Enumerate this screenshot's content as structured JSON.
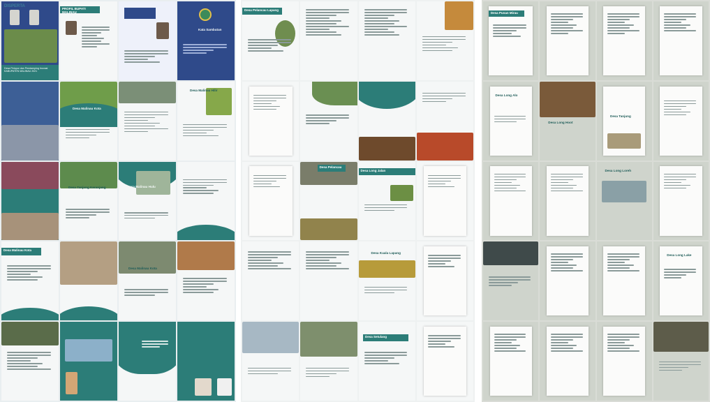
{
  "sheet1": {
    "logo": "DISPERTA",
    "cover_title": "Desa Pelopor dan Pendamping Inovasi KABUPATEN MALINAU 2021",
    "profile_title": "PROFIL BUPATI MALINAU",
    "foreword_title": "Kata Sambutan",
    "village_titles": [
      "Desa Malinau Kota",
      "Desa Malinau Hilir",
      "Desa Tanjung Keranjang",
      "Desa Malinau Hulu",
      "Desa Malinau Kota",
      "Desa Malinau Kota"
    ]
  },
  "sheet2": {
    "village_titles": [
      "Desa Pelancau Lapang",
      "Desa Pelancau",
      "Desa Long Jalan",
      "Desa Kuala Lapang",
      "Desa Setulang"
    ]
  },
  "sheet3": {
    "village_titles": [
      "Desa Punan Mirau",
      "Desa Long Alo",
      "Desa Long Hoot",
      "Desa Long Loreh",
      "Desa Tanjung",
      "Desa Long Lake"
    ]
  }
}
